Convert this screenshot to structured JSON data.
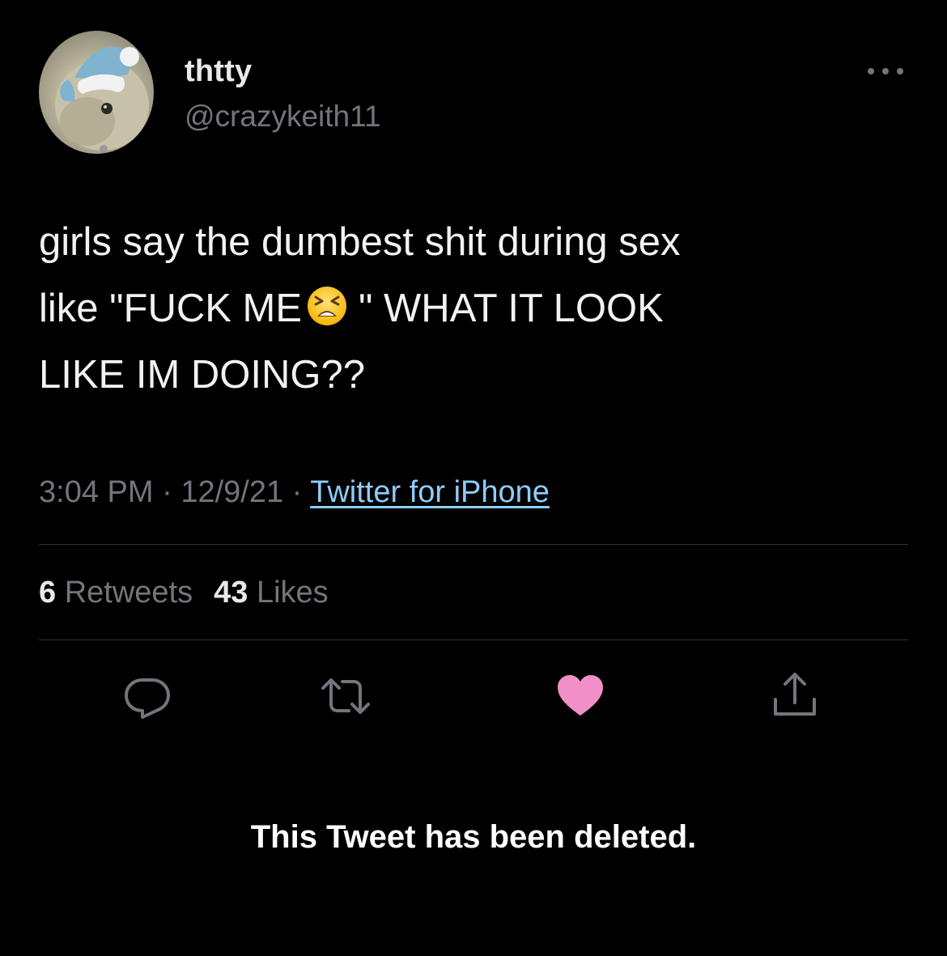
{
  "tweet": {
    "author": {
      "display_name": "thtty",
      "handle": "@crazykeith11"
    },
    "text_line1": "girls say the dumbest shit during sex",
    "text_line2_pre": "like \"FUCK ME",
    "text_line2_post": "\" WHAT IT LOOK",
    "text_line3": "LIKE IM DOING??",
    "emoji": "tired-face-emoji",
    "meta": {
      "time": "3:04 PM",
      "separator": "·",
      "date": "12/9/21",
      "source": "Twitter for iPhone"
    },
    "stats": {
      "retweets_count": "6",
      "retweets_label": "Retweets",
      "likes_count": "43",
      "likes_label": "Likes"
    },
    "actions": {
      "reply_icon": "reply-icon",
      "retweet_icon": "retweet-icon",
      "like_icon": "heart-icon",
      "share_icon": "share-icon"
    },
    "deleted_notice": "This Tweet has been deleted."
  },
  "colors": {
    "background": "#000000",
    "primary_text": "#e7e9ea",
    "secondary_text": "#71767b",
    "link": "#8ecdf8",
    "divider": "#2f3336",
    "liked_heart": "#f18fc8"
  }
}
